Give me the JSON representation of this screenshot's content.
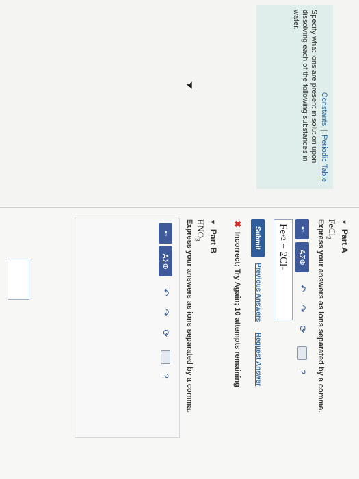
{
  "sidebar": {
    "constants_link": "Constants",
    "separator": "|",
    "periodic_table_link": "Periodic Table",
    "instructions": "Specify what ions are present in solution upon dissolving each of the following substances in water."
  },
  "part_a": {
    "title": "Part A",
    "formula_main": "FeCl",
    "formula_sub": "2",
    "instruction": "Express your answers as ions separated by a comma.",
    "toolbar": {
      "greek_label": "ΑΣΦ",
      "help": "?"
    },
    "answer_base": "Fe",
    "answer_sup": "+2",
    "answer_rest": "+ 2Cl",
    "answer_sup2": "−",
    "submit_label": "Submit",
    "previous_answers": "Previous Answers",
    "request_answer": "Request Answer",
    "feedback": "Incorrect; Try Again; 10 attempts remaining"
  },
  "part_b": {
    "title": "Part B",
    "formula_main": "HNO",
    "formula_sub": "3",
    "instruction": "Express your answers as ions separated by a comma.",
    "toolbar": {
      "greek_label": "ΑΣΦ",
      "help": "?"
    }
  },
  "colors": {
    "accent": "#2f5d9a",
    "info_bg": "#dfeeea",
    "error": "#d0312d"
  },
  "icons": [
    "undo-icon",
    "redo-icon",
    "reset-icon",
    "keyboard-icon",
    "help-icon",
    "feedback-x-icon",
    "mouse-cursor-icon"
  ]
}
